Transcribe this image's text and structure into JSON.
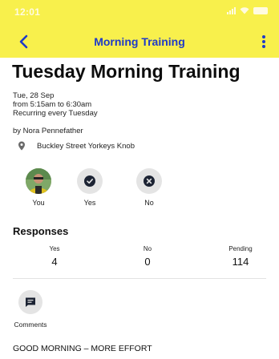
{
  "status_bar": {
    "time": "12:01"
  },
  "app_bar": {
    "title": "Morning Training"
  },
  "event": {
    "title": "Tuesday Morning Training",
    "date": "Tue, 28 Sep",
    "time_range": "from 5:15am to 6:30am",
    "recurrence": "Recurring every Tuesday",
    "organizer": "by Nora Pennefather",
    "location": "Buckley Street Yorkeys Knob"
  },
  "attendance": {
    "you_label": "You",
    "yes_label": "Yes",
    "no_label": "No"
  },
  "responses": {
    "title": "Responses",
    "columns": [
      {
        "label": "Yes",
        "value": "4"
      },
      {
        "label": "No",
        "value": "0"
      },
      {
        "label": "Pending",
        "value": "114"
      }
    ]
  },
  "comments": {
    "label": "Comments"
  },
  "message": "GOOD MORNING – MORE EFFORT",
  "colors": {
    "header_bg": "#f8f04c",
    "accent": "#1e3ac8",
    "icon_dark": "#1c2333"
  }
}
